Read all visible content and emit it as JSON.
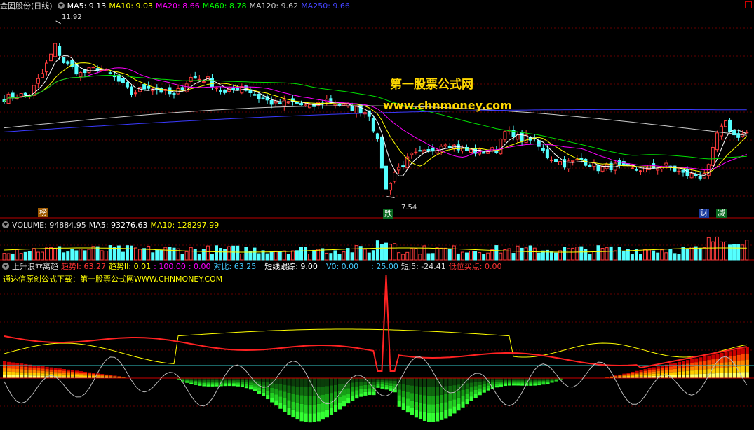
{
  "header_main": {
    "title": "金固股份(日线)",
    "ma5": "MA5: 9.13",
    "ma10": "MA10: 9.03",
    "ma20": "MA20: 8.66",
    "ma60": "MA60: 8.78",
    "ma120": "MA120: 9.62",
    "ma250": "MA250: 9.66"
  },
  "header_volume": {
    "volume": "VOLUME: 94884.95",
    "ma5": "MA5: 93276.63",
    "ma10": "MA10: 128297.99"
  },
  "header_indicator": {
    "name": "上升浪乖离趋",
    "trend1": "趋势I: 63.27",
    "trend2": "趋势II: 0.01",
    "v100": ": 100.00",
    "v0": ": 0.00",
    "duibi": "对比: 63.25",
    "short": "短线跟踪: 9.00",
    "v0b": "V0: 0.00",
    "v25": ": 25.00",
    "j5": "短J5: -24.41",
    "buy": "低位买点: 0.00",
    "line2": "通达信原创公式下载：第一股票公式网WWW.CHNMONEY.COM"
  },
  "annotations": {
    "high": "11.92",
    "low": "7.54",
    "bang": "榜",
    "die": "跌",
    "cai": "财",
    "jian": "减"
  },
  "watermark": {
    "line1": "第一股票公式网",
    "line2": "www.chnmoney.com"
  },
  "colors": {
    "up": "#ff3c3c",
    "down": "#54ffff",
    "ma5": "#ffffff",
    "ma10": "#ffff00",
    "ma20": "#ff00ff",
    "ma60": "#00e000",
    "ma120": "#cccccc",
    "ma250": "#3a3aff"
  },
  "chart_data": {
    "type": "candlestick",
    "series": [
      {
        "name": "MA5",
        "last": 9.13
      },
      {
        "name": "MA10",
        "last": 9.03
      },
      {
        "name": "MA20",
        "last": 8.66
      },
      {
        "name": "MA60",
        "last": 8.78
      },
      {
        "name": "MA120",
        "last": 9.62
      },
      {
        "name": "MA250",
        "last": 9.66
      }
    ],
    "price_anchor_points": [
      [
        0,
        10.0
      ],
      [
        6,
        10.1
      ],
      [
        9,
        10.6
      ],
      [
        12,
        11.3
      ],
      [
        14,
        10.9
      ],
      [
        18,
        10.6
      ],
      [
        22,
        10.75
      ],
      [
        26,
        10.5
      ],
      [
        30,
        10.1
      ],
      [
        34,
        10.3
      ],
      [
        40,
        10.05
      ],
      [
        44,
        10.5
      ],
      [
        48,
        10.45
      ],
      [
        52,
        10.1
      ],
      [
        56,
        10.3
      ],
      [
        60,
        10.0
      ],
      [
        64,
        9.85
      ],
      [
        68,
        9.9
      ],
      [
        72,
        9.75
      ],
      [
        76,
        9.95
      ],
      [
        80,
        9.8
      ],
      [
        84,
        9.7
      ],
      [
        86,
        9.6
      ],
      [
        88,
        8.9
      ],
      [
        90,
        7.7
      ],
      [
        92,
        8.15
      ],
      [
        96,
        8.55
      ],
      [
        100,
        8.65
      ],
      [
        104,
        8.9
      ],
      [
        108,
        8.7
      ],
      [
        112,
        8.65
      ],
      [
        116,
        8.7
      ],
      [
        118,
        9.25
      ],
      [
        120,
        9.0
      ],
      [
        124,
        9.0
      ],
      [
        128,
        8.55
      ],
      [
        132,
        8.35
      ],
      [
        136,
        8.45
      ],
      [
        140,
        8.25
      ],
      [
        144,
        8.3
      ],
      [
        148,
        8.2
      ],
      [
        152,
        8.25
      ],
      [
        156,
        8.3
      ],
      [
        160,
        8.1
      ],
      [
        164,
        8.05
      ],
      [
        166,
        8.25
      ],
      [
        168,
        9.1
      ],
      [
        170,
        9.35
      ],
      [
        172,
        9.05
      ],
      [
        175,
        9.13
      ]
    ],
    "extremes": {
      "high": 11.92,
      "low": 7.54
    },
    "volume": {
      "last": 94884.95,
      "ma5": 93276.63,
      "ma10": 128297.99
    },
    "indicator": {
      "trend1": 63.27,
      "trend2": 0.01,
      "duibi": 63.25,
      "short": 9.0,
      "j5": -24.41,
      "buy": 0.0
    }
  }
}
